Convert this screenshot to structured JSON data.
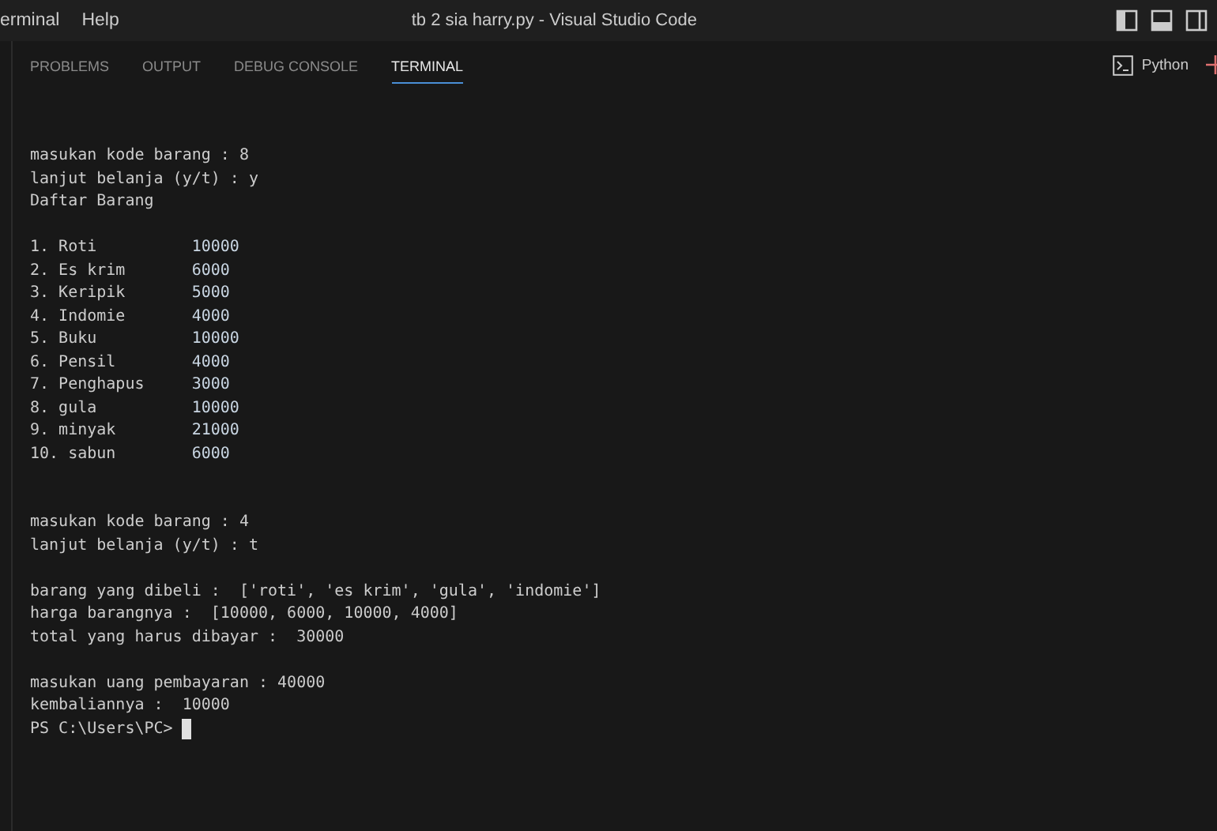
{
  "menu": [
    "erminal",
    "Help"
  ],
  "window": {
    "title": "tb 2 sia harry.py - Visual Studio Code"
  },
  "panel_tabs": [
    {
      "label": "PROBLEMS",
      "selected": false
    },
    {
      "label": "OUTPUT",
      "selected": false
    },
    {
      "label": "DEBUG CONSOLE",
      "selected": false
    },
    {
      "label": "TERMINAL",
      "selected": true
    }
  ],
  "terminal_profile": "Python",
  "terminal": {
    "blocks": [
      {
        "kind": "output",
        "lines": [
          "masukan kode barang : 8",
          "lanjut belanja (y/t) : y",
          "Daftar Barang"
        ]
      },
      {
        "kind": "listing",
        "rows": [
          {
            "name": "1. Roti",
            "price": "10000"
          },
          {
            "name": "2. Es krim",
            "price": "6000"
          },
          {
            "name": "3. Keripik",
            "price": "5000"
          },
          {
            "name": "4. Indomie",
            "price": "4000"
          },
          {
            "name": "5. Buku",
            "price": "10000"
          },
          {
            "name": "6. Pensil",
            "price": "4000"
          },
          {
            "name": "7. Penghapus",
            "price": "3000"
          },
          {
            "name": "8. gula",
            "price": "10000"
          },
          {
            "name": "9. minyak",
            "price": "21000"
          },
          {
            "name": "10. sabun",
            "price": "6000"
          }
        ]
      },
      {
        "kind": "output",
        "lines": [
          "masukan kode barang : 4",
          "lanjut belanja (y/t) : t"
        ]
      },
      {
        "kind": "output",
        "lines": [
          "barang yang dibeli :  ['roti', 'es krim', 'gula', 'indomie']",
          "harga barangnya :  [10000, 6000, 10000, 4000]",
          "total yang harus dibayar :  30000"
        ]
      },
      {
        "kind": "output",
        "lines": [
          "masukan uang pembayaran : 40000",
          "kembaliannya :  10000"
        ]
      }
    ],
    "prompt": "PS C:\\Users\\PC>"
  }
}
